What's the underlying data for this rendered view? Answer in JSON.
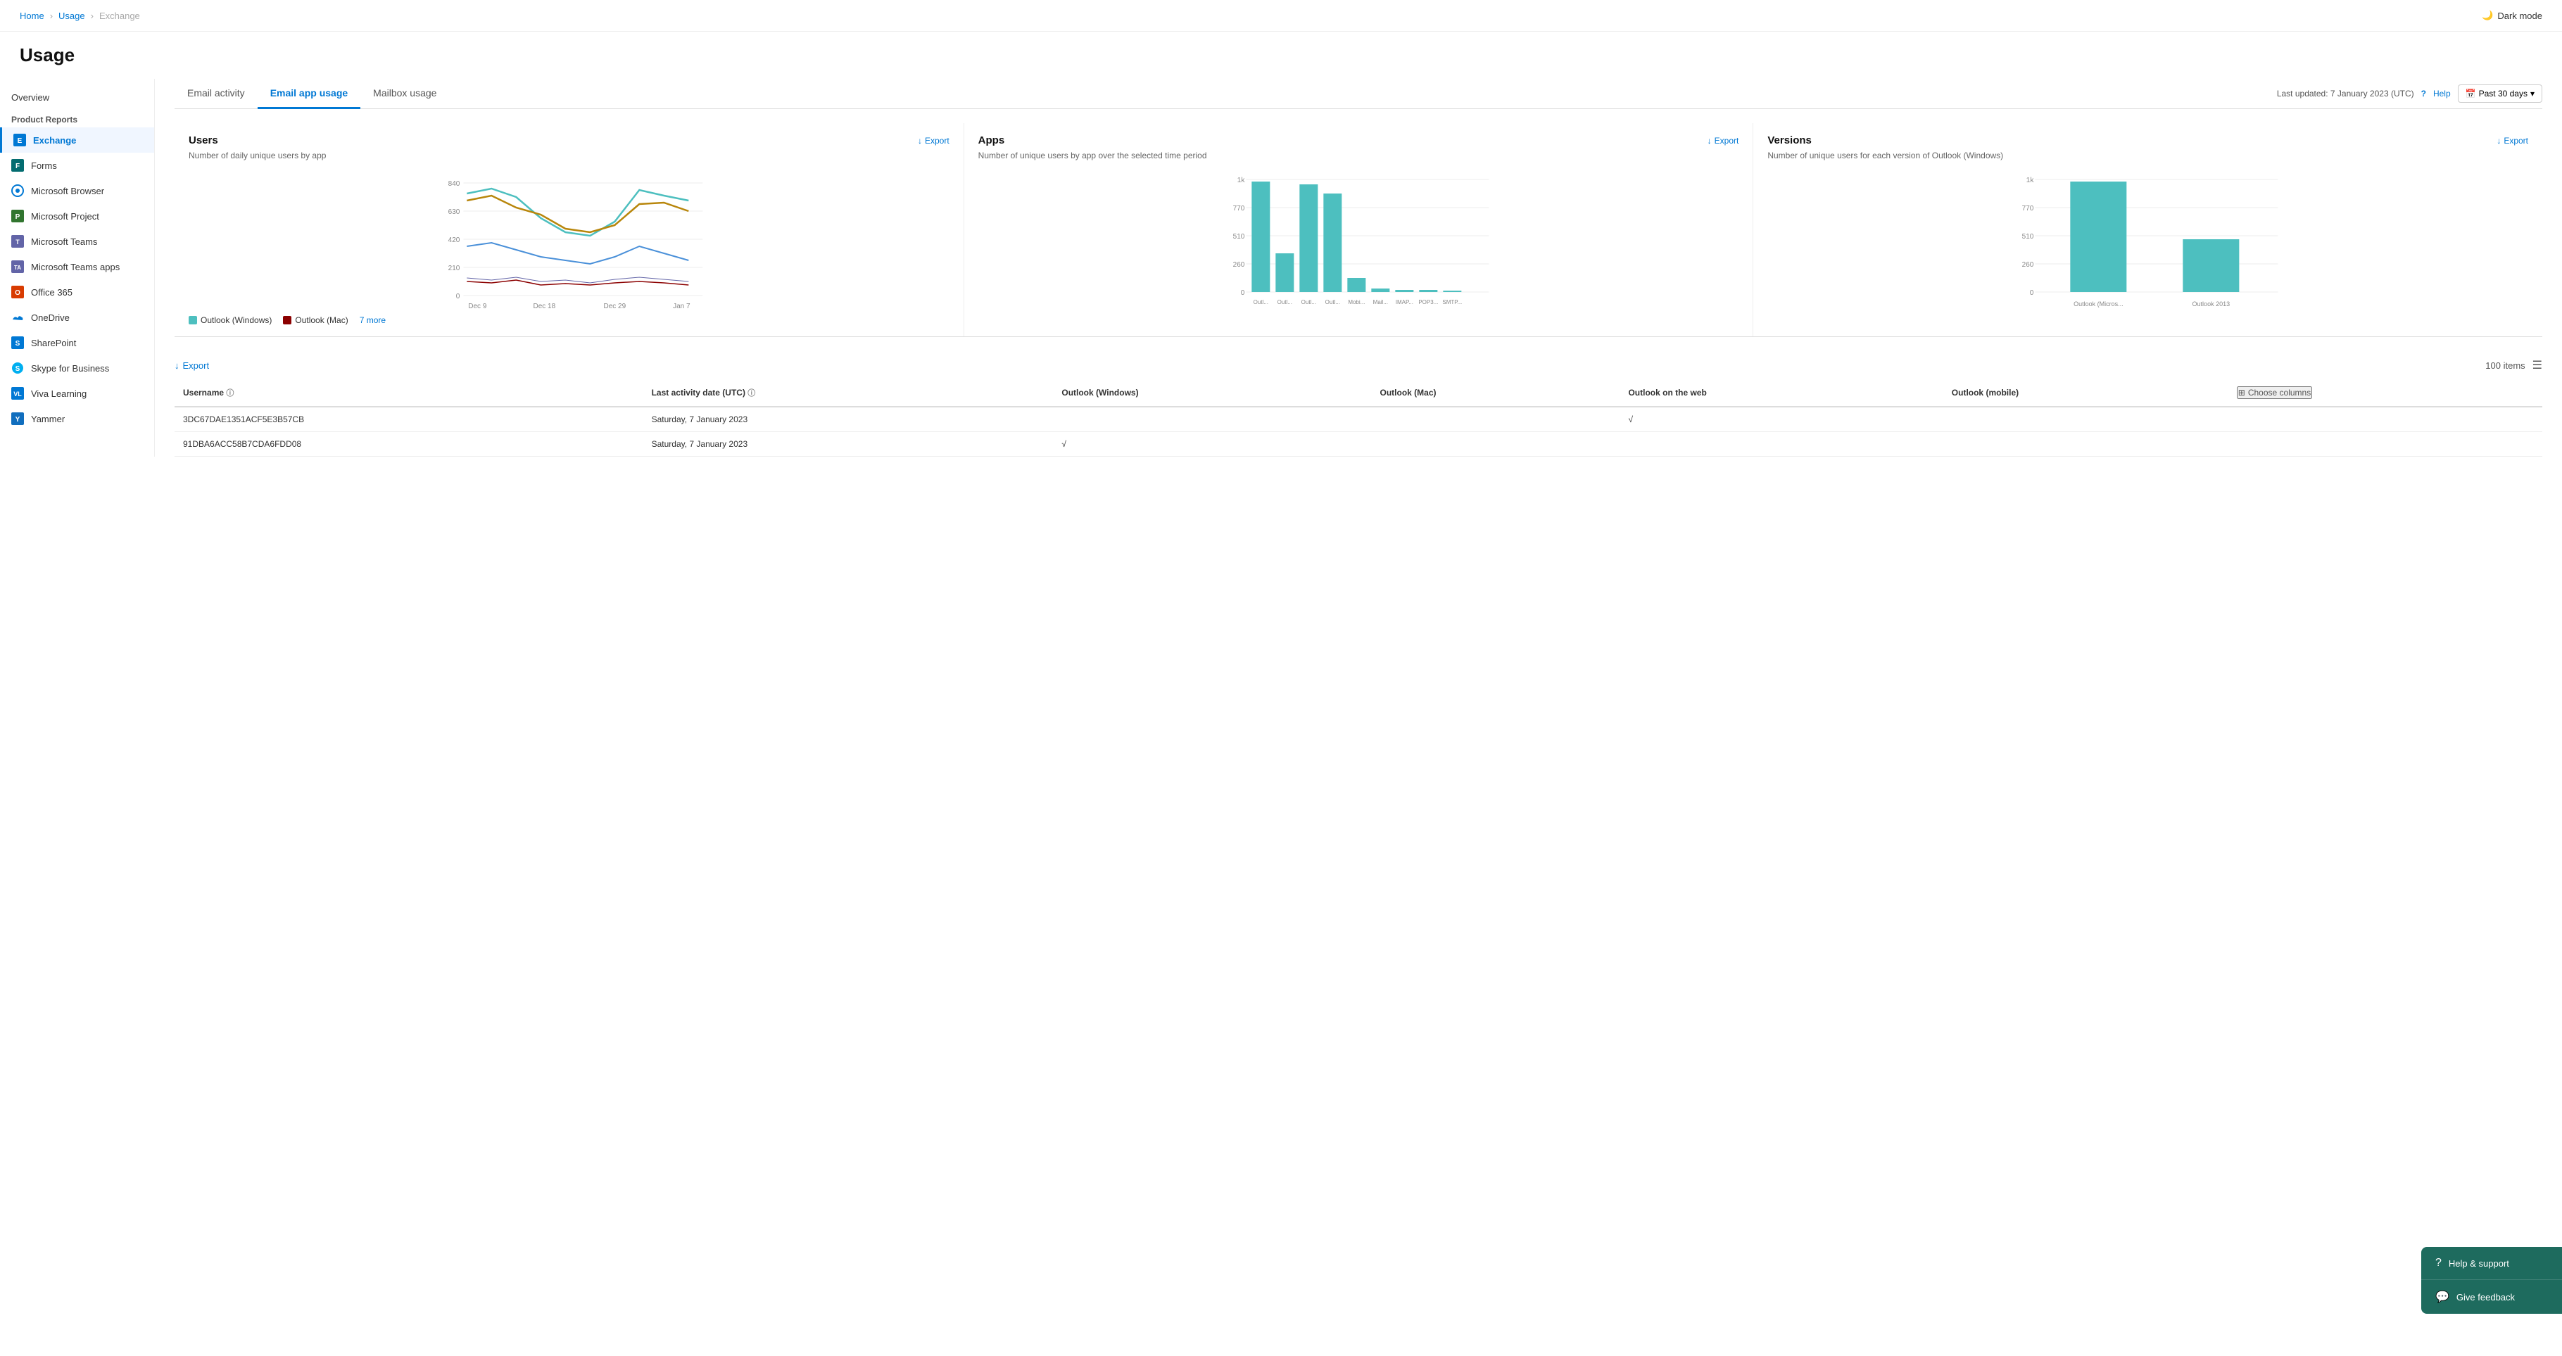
{
  "breadcrumb": {
    "items": [
      "Home",
      "Usage",
      "Exchange"
    ]
  },
  "darkMode": {
    "label": "Dark mode"
  },
  "pageTitle": "Usage",
  "sidebar": {
    "overview": "Overview",
    "productReports": "Product Reports",
    "items": [
      {
        "id": "exchange",
        "label": "Exchange",
        "active": true
      },
      {
        "id": "forms",
        "label": "Forms",
        "active": false
      },
      {
        "id": "microsoft-browser",
        "label": "Microsoft Browser",
        "active": false
      },
      {
        "id": "microsoft-project",
        "label": "Microsoft Project",
        "active": false
      },
      {
        "id": "microsoft-teams",
        "label": "Microsoft Teams",
        "active": false
      },
      {
        "id": "microsoft-teams-apps",
        "label": "Microsoft Teams apps",
        "active": false
      },
      {
        "id": "office-365",
        "label": "Office 365",
        "active": false
      },
      {
        "id": "onedrive",
        "label": "OneDrive",
        "active": false
      },
      {
        "id": "sharepoint",
        "label": "SharePoint",
        "active": false
      },
      {
        "id": "skype",
        "label": "Skype for Business",
        "active": false
      },
      {
        "id": "viva-learning",
        "label": "Viva Learning",
        "active": false
      },
      {
        "id": "yammer",
        "label": "Yammer",
        "active": false
      }
    ]
  },
  "tabs": {
    "items": [
      {
        "id": "email-activity",
        "label": "Email activity",
        "active": false
      },
      {
        "id": "email-app-usage",
        "label": "Email app usage",
        "active": true
      },
      {
        "id": "mailbox-usage",
        "label": "Mailbox usage",
        "active": false
      }
    ],
    "lastUpdated": "Last updated: 7 January 2023 (UTC)",
    "help": "Help",
    "dateRange": "Past 30 days"
  },
  "charts": {
    "users": {
      "title": "Users",
      "exportLabel": "Export",
      "subtitle": "Number of daily unique users by app",
      "yLabels": [
        "840",
        "630",
        "420",
        "210",
        "0"
      ],
      "xLabels": [
        "Dec 9",
        "Dec 18",
        "Dec 29",
        "Jan 7"
      ],
      "legend": {
        "items": [
          {
            "label": "Outlook (Windows)",
            "color": "#4dbfbf"
          },
          {
            "label": "Outlook (Mac)",
            "color": "#8b0000"
          }
        ],
        "moreLabel": "7 more"
      }
    },
    "apps": {
      "title": "Apps",
      "exportLabel": "Export",
      "subtitle": "Number of unique users by app over the selected time period",
      "yLabels": [
        "1k",
        "770",
        "510",
        "260",
        "0"
      ],
      "xLabels": [
        "Outl...",
        "Outl...",
        "Outl...",
        "Outl...",
        "Mobi...",
        "Mail...",
        "IMAP...",
        "POP3...",
        "SMTP..."
      ]
    },
    "versions": {
      "title": "Versions",
      "exportLabel": "Export",
      "subtitle": "Number of unique users for each version of Outlook (Windows)",
      "yLabels": [
        "1k",
        "770",
        "510",
        "260",
        "0"
      ],
      "xLabels": [
        "Outlook (Micros...",
        "Outlook 2013"
      ]
    }
  },
  "table": {
    "exportLabel": "Export",
    "itemsCount": "100 items",
    "columns": [
      {
        "id": "username",
        "label": "Username",
        "hasInfo": true
      },
      {
        "id": "last-activity",
        "label": "Last activity date (UTC)",
        "hasInfo": true
      },
      {
        "id": "outlook-windows",
        "label": "Outlook (Windows)",
        "hasInfo": false
      },
      {
        "id": "outlook-mac",
        "label": "Outlook (Mac)",
        "hasInfo": false
      },
      {
        "id": "outlook-web",
        "label": "Outlook on the web",
        "hasInfo": false
      },
      {
        "id": "outlook-mobile",
        "label": "Outlook (mobile)",
        "hasInfo": false
      }
    ],
    "chooseColumns": "Choose columns",
    "rows": [
      {
        "username": "3DC67DAE1351ACF5E3B57CB",
        "lastActivity": "Saturday, 7 January 2023",
        "windows": "",
        "mac": "",
        "web": "√",
        "mobile": ""
      },
      {
        "username": "91DBA6ACC58B7CDA6FDD08",
        "lastActivity": "Saturday, 7 January 2023",
        "windows": "√",
        "mac": "",
        "web": "",
        "mobile": ""
      }
    ]
  },
  "floatingPanel": {
    "items": [
      {
        "id": "help-support",
        "label": "Help & support",
        "icon": "?"
      },
      {
        "id": "give-feedback",
        "label": "Give feedback",
        "icon": "💬"
      }
    ]
  }
}
